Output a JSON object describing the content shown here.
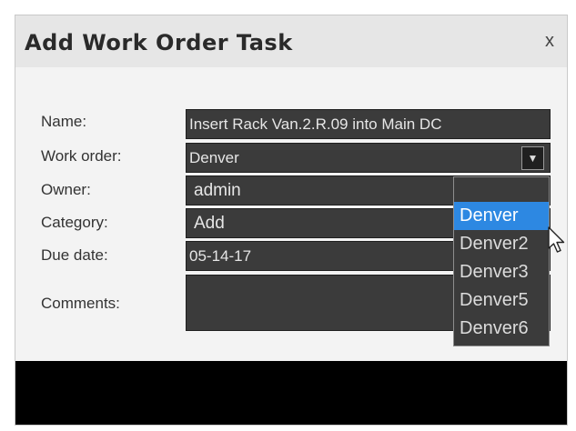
{
  "dialog": {
    "title": "Add Work Order Task",
    "close": "x"
  },
  "form": {
    "name_label": "Name:",
    "name_value": "Insert Rack Van.2.R.09 into Main DC",
    "work_order_label": "Work order:",
    "work_order_value": "Denver",
    "owner_label": "Owner:",
    "owner_value": "admin",
    "category_label": "Category:",
    "category_value": "Add",
    "due_label": "Due date:",
    "due_value": "05-14-17",
    "comments_label": "Comments:",
    "dropdown_arrow": "▼"
  },
  "dropdown": {
    "options": [
      "Denver",
      "Denver2",
      "Denver3",
      "Denver5",
      "Denver6"
    ],
    "selected": "Denver",
    "highlight_color": "#2d88e2"
  }
}
